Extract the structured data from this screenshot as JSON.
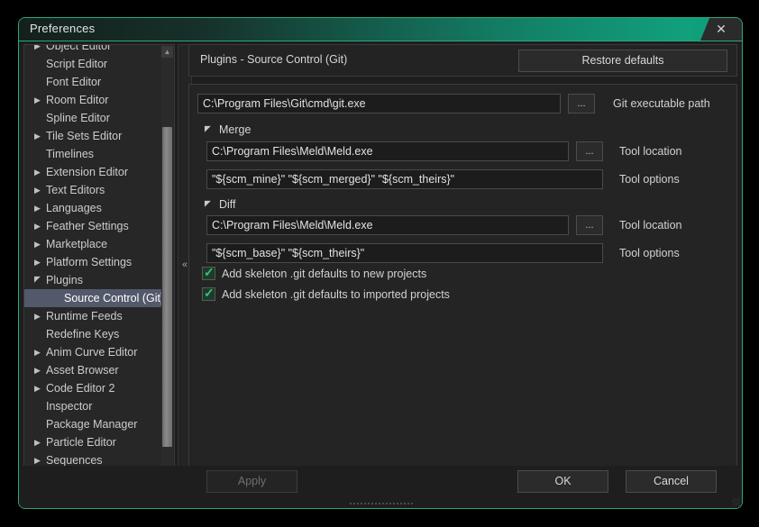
{
  "window": {
    "title": "Preferences",
    "close_label": "✕",
    "collapse_label": "«"
  },
  "sidebar": {
    "items": [
      {
        "label": "Object Editor",
        "arrow": "closed",
        "level": 1,
        "selected": false,
        "clipped": true
      },
      {
        "label": "Script Editor",
        "arrow": "none",
        "level": 1,
        "selected": false
      },
      {
        "label": "Font Editor",
        "arrow": "none",
        "level": 1,
        "selected": false
      },
      {
        "label": "Room Editor",
        "arrow": "closed",
        "level": 1,
        "selected": false
      },
      {
        "label": "Spline Editor",
        "arrow": "none",
        "level": 1,
        "selected": false
      },
      {
        "label": "Tile Sets Editor",
        "arrow": "closed",
        "level": 1,
        "selected": false
      },
      {
        "label": "Timelines",
        "arrow": "none",
        "level": 1,
        "selected": false
      },
      {
        "label": "Extension Editor",
        "arrow": "closed",
        "level": 1,
        "selected": false
      },
      {
        "label": "Text Editors",
        "arrow": "closed",
        "level": 1,
        "selected": false
      },
      {
        "label": "Languages",
        "arrow": "closed",
        "level": 1,
        "selected": false
      },
      {
        "label": "Feather Settings",
        "arrow": "closed",
        "level": 1,
        "selected": false
      },
      {
        "label": "Marketplace",
        "arrow": "closed",
        "level": 1,
        "selected": false
      },
      {
        "label": "Platform Settings",
        "arrow": "closed",
        "level": 1,
        "selected": false
      },
      {
        "label": "Plugins",
        "arrow": "open",
        "level": 1,
        "selected": false
      },
      {
        "label": "Source Control (Git)",
        "arrow": "none",
        "level": 2,
        "selected": true
      },
      {
        "label": "Runtime Feeds",
        "arrow": "closed",
        "level": 1,
        "selected": false
      },
      {
        "label": "Redefine Keys",
        "arrow": "none",
        "level": 1,
        "selected": false
      },
      {
        "label": "Anim Curve Editor",
        "arrow": "closed",
        "level": 1,
        "selected": false
      },
      {
        "label": "Asset Browser",
        "arrow": "closed",
        "level": 1,
        "selected": false
      },
      {
        "label": "Code Editor 2",
        "arrow": "closed",
        "level": 1,
        "selected": false
      },
      {
        "label": "Inspector",
        "arrow": "none",
        "level": 1,
        "selected": false
      },
      {
        "label": "Package Manager",
        "arrow": "none",
        "level": 1,
        "selected": false
      },
      {
        "label": "Particle Editor",
        "arrow": "closed",
        "level": 1,
        "selected": false
      },
      {
        "label": "Sequences",
        "arrow": "closed",
        "level": 1,
        "selected": false
      }
    ],
    "scrollbar": {
      "up_arrow": "▲",
      "down_arrow": "▼"
    }
  },
  "main": {
    "header_title": "Plugins - Source Control (Git)",
    "restore_defaults_label": "Restore defaults",
    "git_path": {
      "value": "C:\\Program Files\\Git\\cmd\\git.exe",
      "browse_label": "...",
      "label": "Git executable path"
    },
    "merge": {
      "group_label": "Merge",
      "tool_location": {
        "value": "C:\\Program Files\\Meld\\Meld.exe",
        "browse_label": "...",
        "label": "Tool location"
      },
      "tool_options": {
        "value": "\"${scm_mine}\" \"${scm_merged}\" \"${scm_theirs}\"",
        "label": "Tool options"
      }
    },
    "diff": {
      "group_label": "Diff",
      "tool_location": {
        "value": "C:\\Program Files\\Meld\\Meld.exe",
        "browse_label": "...",
        "label": "Tool location"
      },
      "tool_options": {
        "value": "\"${scm_base}\" \"${scm_theirs}\"",
        "label": "Tool options"
      }
    },
    "checkboxes": [
      {
        "label": "Add skeleton .git defaults to new projects",
        "checked": true
      },
      {
        "label": "Add skeleton .git defaults to imported projects",
        "checked": true
      }
    ]
  },
  "footer": {
    "apply_label": "Apply",
    "apply_enabled": false,
    "ok_label": "OK",
    "cancel_label": "Cancel"
  },
  "colors": {
    "accent": "#2aa87a",
    "titlebar_end": "#11a07c",
    "selection": "#52596b",
    "check": "#3fbf72",
    "panel_bg": "#242424",
    "window_bg": "#1e1e1e"
  }
}
